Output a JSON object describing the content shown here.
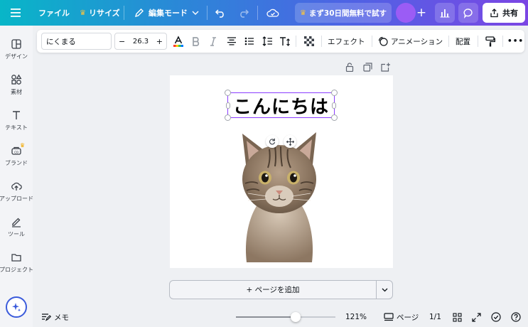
{
  "topbar": {
    "file_label": "ファイル",
    "resize_label": "リサイズ",
    "edit_mode_label": "編集モード",
    "trial_label": "まず30日間無料で試す",
    "share_label": "共有"
  },
  "sidebar": {
    "items": [
      {
        "label": "デザイン",
        "icon": "layout-icon"
      },
      {
        "label": "素材",
        "icon": "shapes-icon"
      },
      {
        "label": "テキスト",
        "icon": "text-icon"
      },
      {
        "label": "ブランド",
        "icon": "brand-icon"
      },
      {
        "label": "アップロード",
        "icon": "upload-icon"
      },
      {
        "label": "ツール",
        "icon": "pen-icon"
      },
      {
        "label": "プロジェクト",
        "icon": "folder-icon"
      }
    ]
  },
  "toolbar": {
    "font_name": "にくまる",
    "font_size": "26.3",
    "minus": "−",
    "plus": "+",
    "effects_label": "エフェクト",
    "animation_label": "アニメーション",
    "position_label": "配置",
    "more": "•••"
  },
  "canvas": {
    "title_text": "こんにちは",
    "add_page_label": "+ ページを追加"
  },
  "bottombar": {
    "notes_label": "メモ",
    "zoom_level": "121%",
    "zoom_fraction": 0.6,
    "pages_label": "ページ",
    "page_count": "1/1"
  },
  "colors": {
    "accent_purple": "#8b3dff",
    "crown": "#f2a800"
  }
}
